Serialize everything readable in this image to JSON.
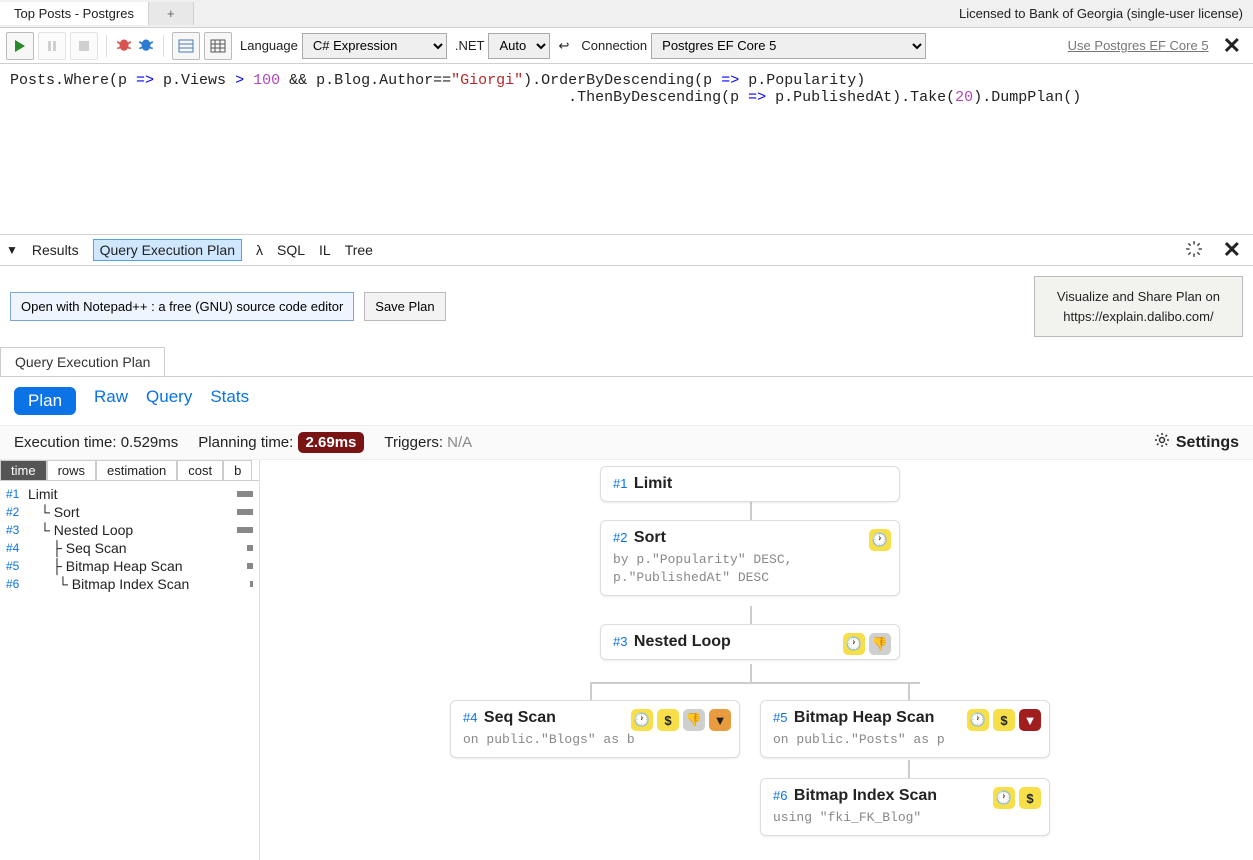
{
  "tabs": {
    "main": "Top Posts - Postgres",
    "add": "+"
  },
  "license": "Licensed to Bank of Georgia (single-user license)",
  "toolbar": {
    "language_label": "Language",
    "language_value": "C# Expression",
    "net_label": ".NET",
    "net_value": "Auto",
    "connection_label": "Connection",
    "connection_value": "Postgres EF Core 5",
    "conn_link": "Use Postgres EF Core 5"
  },
  "code": {
    "l1a": "Posts.Where(p ",
    "l1b": "=>",
    "l1c": " p.Views ",
    "l1d": ">",
    "l1e": " ",
    "l1num": "100",
    "l1f": " && p.Blog.Author==",
    "l1str": "\"Giorgi\"",
    "l1g": ").OrderByDescending(p ",
    "l1h": "=>",
    "l1i": " p.Popularity)",
    "l2a": ".ThenByDescending(p ",
    "l2b": "=>",
    "l2c": " p.PublishedAt).Take(",
    "l2num": "20",
    "l2d": ").DumpPlan()"
  },
  "results_bar": {
    "results": "Results",
    "plan": "Query Execution Plan",
    "lambda": "λ",
    "sql": "SQL",
    "il": "IL",
    "tree": "Tree"
  },
  "plan_actions": {
    "open_np": "Open with Notepad++ : a free (GNU) source code editor",
    "save": "Save Plan",
    "dalibo1": "Visualize and Share Plan on",
    "dalibo2": "https://explain.dalibo.com/"
  },
  "result_tab": "Query Execution Plan",
  "pills": {
    "plan": "Plan",
    "raw": "Raw",
    "query": "Query",
    "stats": "Stats"
  },
  "stats": {
    "exec_label": "Execution time: ",
    "exec_val": "0.529ms",
    "plan_label": "Planning time: ",
    "plan_val": "2.69ms",
    "trig_label": "Triggers: ",
    "trig_val": "N/A",
    "settings": "Settings"
  },
  "metric_tabs": {
    "time": "time",
    "rows": "rows",
    "estimation": "estimation",
    "cost": "cost",
    "b": "b"
  },
  "tree": [
    {
      "id": "#1",
      "name": "Limit",
      "indent": ""
    },
    {
      "id": "#2",
      "name": "└ Sort",
      "indent": "indent1"
    },
    {
      "id": "#3",
      "name": "└ Nested Loop",
      "indent": "indent1"
    },
    {
      "id": "#4",
      "name": "├ Seq Scan",
      "indent": "indent2"
    },
    {
      "id": "#5",
      "name": "├ Bitmap Heap Scan",
      "indent": "indent2"
    },
    {
      "id": "#6",
      "name": "└ Bitmap Index Scan",
      "indent": "indent3"
    }
  ],
  "nodes": {
    "n1": {
      "id": "#1",
      "title": "Limit"
    },
    "n2": {
      "id": "#2",
      "title": "Sort",
      "sub1": "by p.\"Popularity\" DESC,",
      "sub2": "p.\"PublishedAt\" DESC"
    },
    "n3": {
      "id": "#3",
      "title": "Nested Loop"
    },
    "n4": {
      "id": "#4",
      "title": "Seq Scan",
      "sub": "on public.\"Blogs\" as b"
    },
    "n5": {
      "id": "#5",
      "title": "Bitmap Heap Scan",
      "sub": "on public.\"Posts\" as p"
    },
    "n6": {
      "id": "#6",
      "title": "Bitmap Index Scan",
      "sub": "using \"fki_FK_Blog\""
    }
  }
}
